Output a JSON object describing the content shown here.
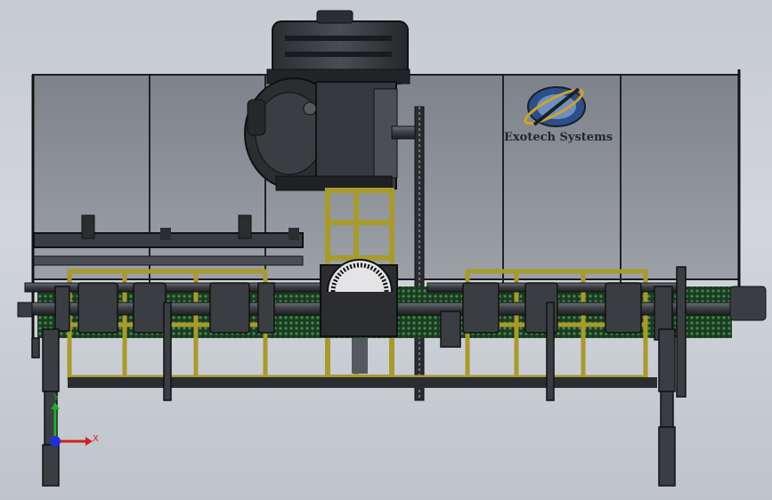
{
  "viewport": {
    "background_top": "#c6cad1",
    "background_bottom": "#bfc4cc"
  },
  "model": {
    "logo_text": "Exotech Systems",
    "colors": {
      "frame_yellow": "#a99a2c",
      "steel_dark": "#2c2f35",
      "panel_gray": "#8b8f97",
      "mesh_green": "#2f6a3a"
    }
  },
  "triad": {
    "x_label": "X",
    "y_label": "Y",
    "x_color": "#d12020",
    "y_color": "#1fae2a",
    "z_color": "#2030d8"
  }
}
